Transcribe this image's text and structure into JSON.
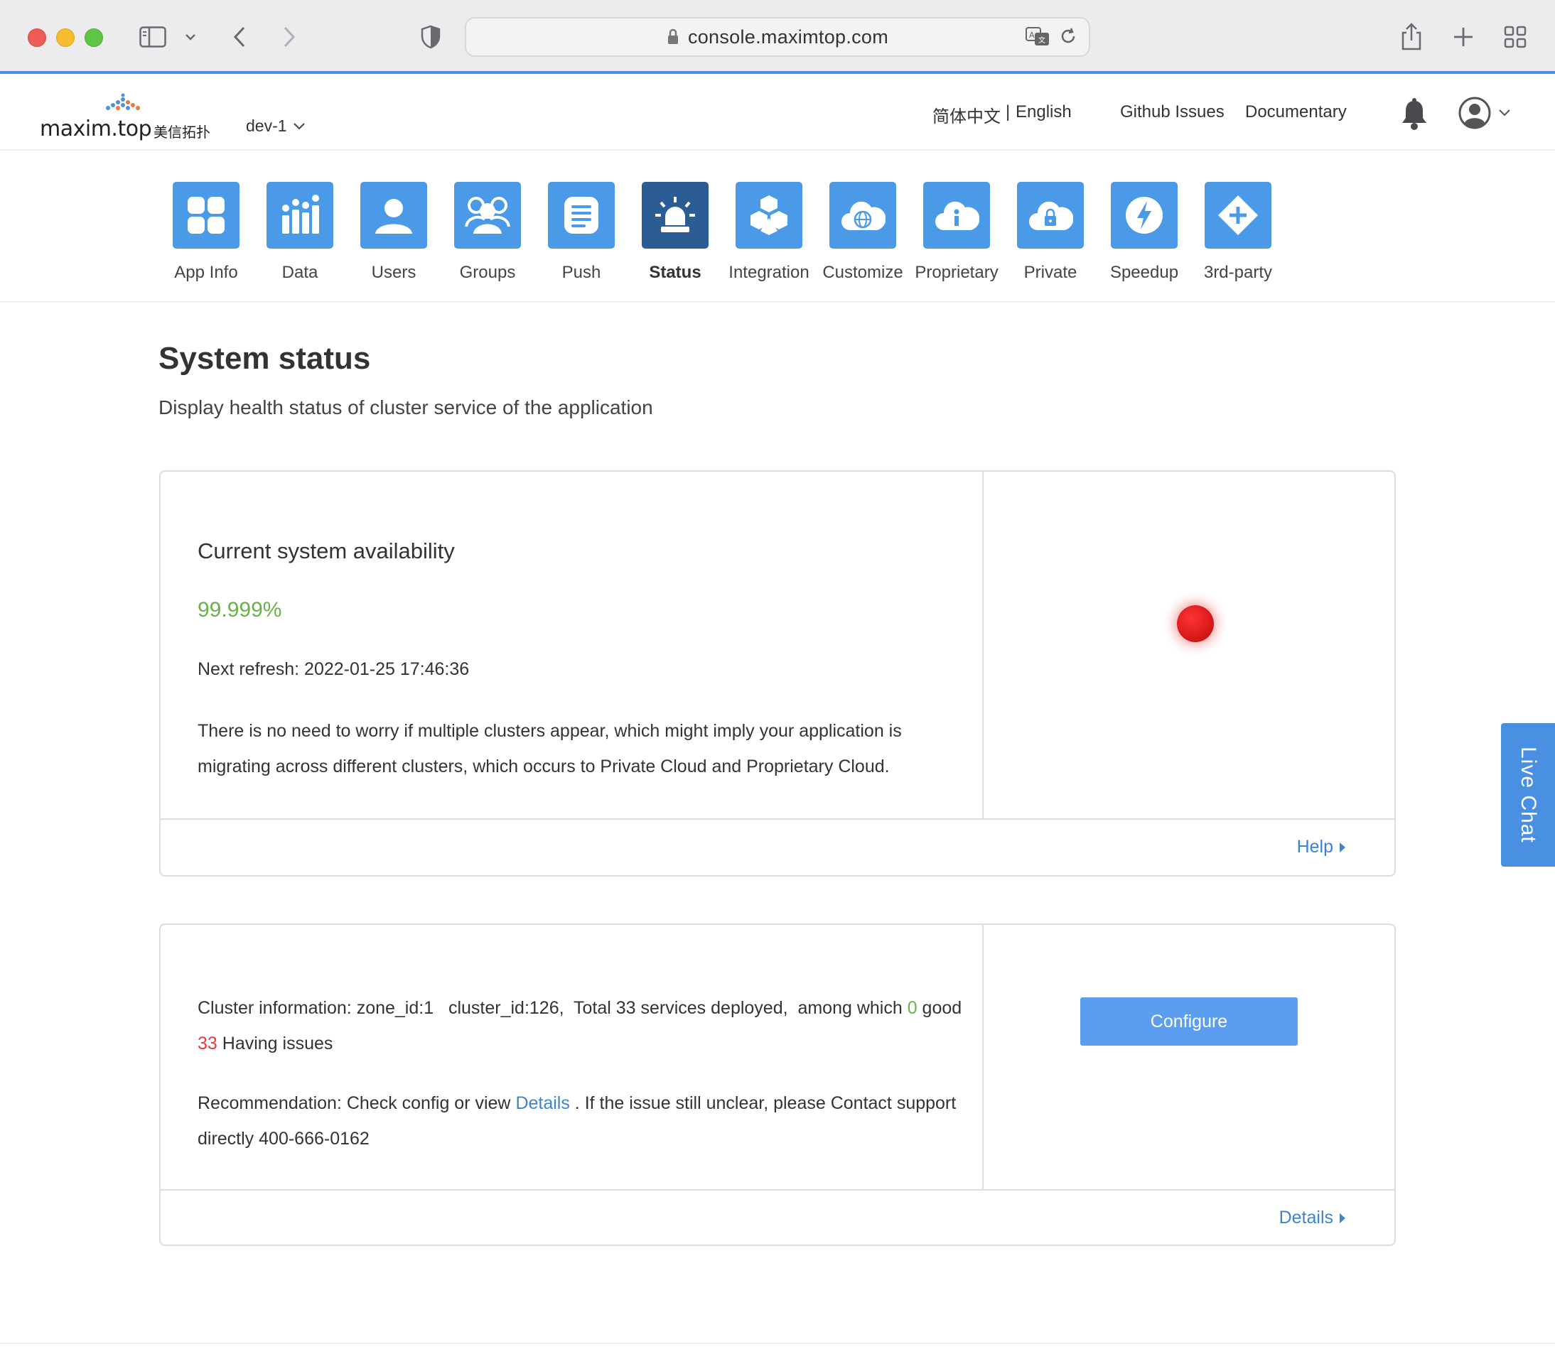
{
  "browser": {
    "url": "console.maximtop.com"
  },
  "header": {
    "logo_text": "maxim.top",
    "logo_cn": "美信拓扑",
    "env": "dev-1",
    "lang_zh": "简体中文",
    "lang_sep": "|",
    "lang_en": "English",
    "github": "Github Issues",
    "docs": "Documentary"
  },
  "nav": {
    "items": [
      {
        "label": "App Info",
        "icon": "app-info-icon"
      },
      {
        "label": "Data",
        "icon": "data-icon"
      },
      {
        "label": "Users",
        "icon": "users-icon"
      },
      {
        "label": "Groups",
        "icon": "groups-icon"
      },
      {
        "label": "Push",
        "icon": "push-icon"
      },
      {
        "label": "Status",
        "icon": "status-icon",
        "active": true
      },
      {
        "label": "Integration",
        "icon": "integration-icon"
      },
      {
        "label": "Customize",
        "icon": "customize-icon"
      },
      {
        "label": "Proprietary",
        "icon": "proprietary-icon"
      },
      {
        "label": "Private",
        "icon": "private-icon"
      },
      {
        "label": "Speedup",
        "icon": "speedup-icon"
      },
      {
        "label": "3rd-party",
        "icon": "third-party-icon"
      }
    ]
  },
  "page": {
    "title": "System status",
    "subtitle": "Display health status of cluster service of the application"
  },
  "availability": {
    "title": "Current system availability",
    "value": "99.999%",
    "refresh_label": "Next refresh: 2022-01-25 17:46:36",
    "note": "There is no need to worry if multiple clusters appear, which might imply your application is migrating across different clusters, which occurs to Private Cloud and Proprietary Cloud.",
    "status_color": "#e02020",
    "help_link": "Help"
  },
  "cluster": {
    "info_prefix": "Cluster information: zone_id:1   cluster_id:126,  Total 33 services deployed,  among which ",
    "good_count": "0",
    "good_label": " good ",
    "bad_count": "33",
    "bad_label": " Having issues",
    "rec_prefix": "Recommendation: Check config or view ",
    "rec_link": "Details",
    "rec_suffix": " . If the issue still unclear, please Contact support directly 400-666-0162",
    "configure_button": "Configure",
    "details_link": "Details"
  },
  "live_chat": "Live Chat",
  "colors": {
    "accent": "#4a90e2",
    "nav_tile": "#4a9ae8",
    "nav_tile_active": "#2b5c94",
    "good": "#6ab04c",
    "bad": "#e83a3a"
  }
}
